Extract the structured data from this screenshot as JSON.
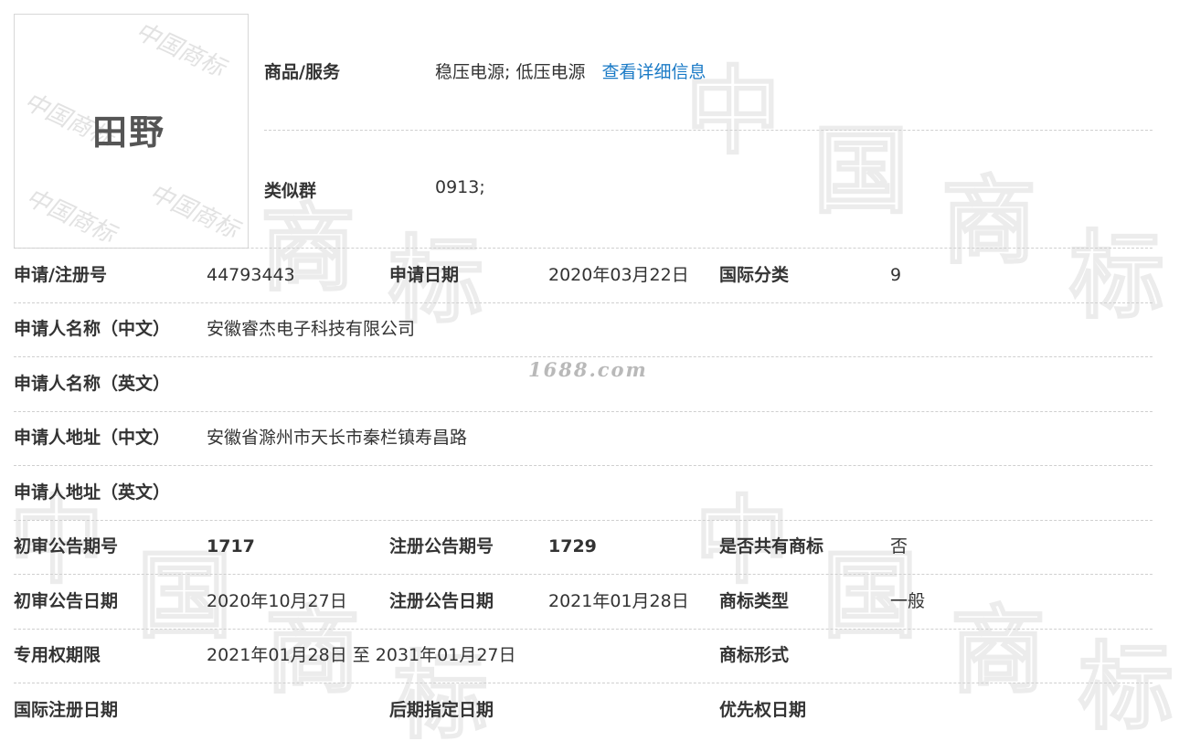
{
  "logo": {
    "text": "田野",
    "watermark_text": "中国商标"
  },
  "watermark": {
    "site": "1688.com",
    "glyphs": [
      "中",
      "国",
      "商",
      "标"
    ]
  },
  "goods_services": {
    "label": "商品/服务",
    "value": "稳压电源; 低压电源",
    "link": "查看详细信息"
  },
  "similar_group": {
    "label": "类似群",
    "value": "0913;"
  },
  "rows": [
    {
      "label": "申请/注册号",
      "value": "44793443",
      "label2": "申请日期",
      "value2": "2020年03月22日",
      "label3": "国际分类",
      "value3": "9"
    },
    {
      "label": "申请人名称（中文）",
      "value": "安徽睿杰电子科技有限公司"
    },
    {
      "label": "申请人名称（英文）",
      "value": ""
    },
    {
      "label": "申请人地址（中文）",
      "value": "安徽省滁州市天长市秦栏镇寿昌路"
    },
    {
      "label": "申请人地址（英文）",
      "value": ""
    },
    {
      "label": "初审公告期号",
      "value": "1717",
      "label2": "注册公告期号",
      "value2": "1729",
      "label3": "是否共有商标",
      "value3": "否"
    },
    {
      "label": "初审公告日期",
      "value": "2020年10月27日",
      "label2": "注册公告日期",
      "value2": "2021年01月28日",
      "label3": "商标类型",
      "value3": "一般"
    },
    {
      "label": "专用权期限",
      "value": "2021年01月28日 至 2031年01月27日",
      "label2": "",
      "value2": "",
      "label3": "商标形式",
      "value3": ""
    },
    {
      "label": "国际注册日期",
      "value": "",
      "label2": "后期指定日期",
      "value2": "",
      "label3": "优先权日期",
      "value3": ""
    }
  ],
  "colors": {
    "link": "#1a7ac6",
    "text": "#333333",
    "divider": "#cfcfcf"
  }
}
